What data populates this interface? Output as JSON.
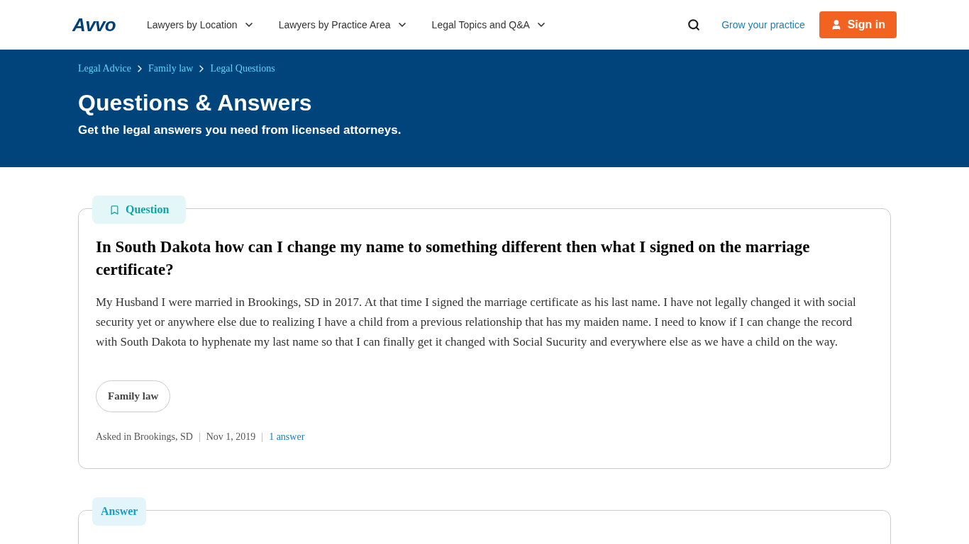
{
  "header": {
    "logo": "Avvo",
    "nav": [
      {
        "label": "Lawyers by Location"
      },
      {
        "label": "Lawyers by Practice Area"
      },
      {
        "label": "Legal Topics and Q&A"
      }
    ],
    "grow_link": "Grow your practice",
    "sign_in": "Sign in"
  },
  "banner": {
    "breadcrumbs": [
      "Legal Advice",
      "Family law",
      "Legal Questions"
    ],
    "title": "Questions & Answers",
    "subtitle": "Get the legal answers you need from licensed attorneys."
  },
  "question": {
    "label": "Question",
    "title": "In South Dakota how can I change my name to something different then what I signed on the marriage certificate?",
    "body": "My Husband I were married in Brookings, SD in 2017. At that time I signed the marriage certificate as his last name. I have not legally changed it with social security yet or anywhere else due to realizing I have a child from a previous relationship that has my maiden name. I need to know if I can change the record with South Dakota to hyphenate my last name so that I can finally get it changed with Social Sucurity and everywhere else as we have a child on the way.",
    "tags": [
      "Family law"
    ],
    "meta": [
      {
        "kind": "text",
        "text": "Asked in Brookings, SD"
      },
      {
        "kind": "separator",
        "text": "|"
      },
      {
        "kind": "text",
        "text": "Nov 1, 2019"
      },
      {
        "kind": "separator",
        "text": "|"
      },
      {
        "kind": "link",
        "text": "1 answer"
      }
    ]
  },
  "answer": {
    "label": "Answer"
  }
}
